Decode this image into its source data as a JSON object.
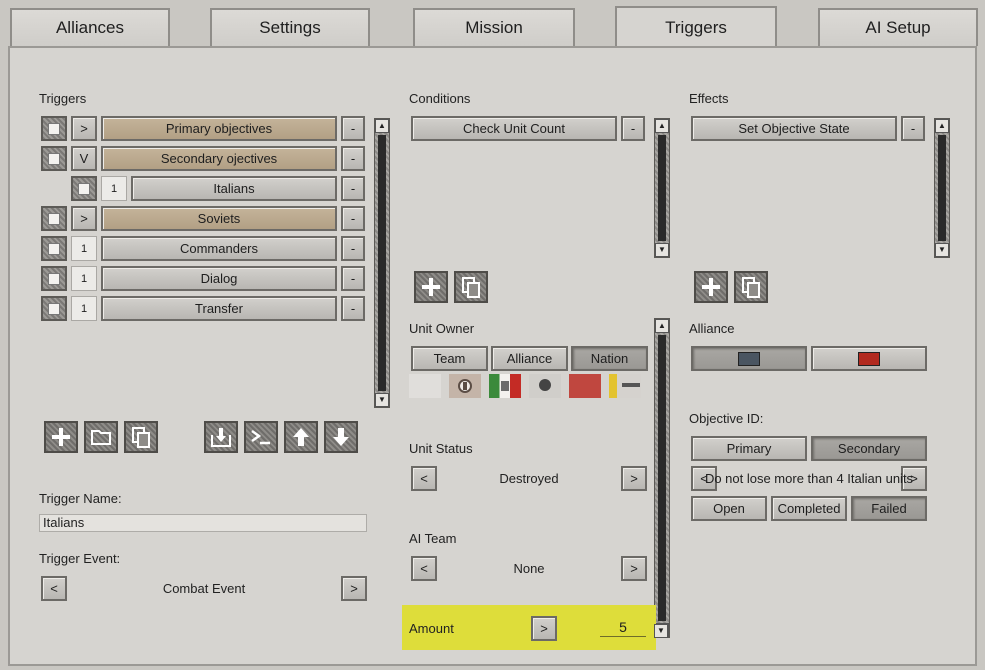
{
  "tabs": [
    {
      "label": "Alliances"
    },
    {
      "label": "Settings"
    },
    {
      "label": "Mission"
    },
    {
      "label": "Triggers"
    },
    {
      "label": "AI Setup"
    }
  ],
  "triggers": {
    "heading": "Triggers",
    "items": [
      {
        "expander": ">",
        "label": "Primary objectives",
        "minus": "-"
      },
      {
        "expander": "V",
        "label": "Secondary ojectives",
        "minus": "-"
      },
      {
        "expander": "1",
        "label": "Italians",
        "minus": "-"
      },
      {
        "expander": ">",
        "label": "Soviets",
        "minus": "-"
      },
      {
        "expander": "1",
        "label": "Commanders",
        "minus": "-"
      },
      {
        "expander": "1",
        "label": "Dialog",
        "minus": "-"
      },
      {
        "expander": "1",
        "label": "Transfer",
        "minus": "-"
      }
    ],
    "trigger_name_label": "Trigger Name:",
    "trigger_name_value": "Italians",
    "trigger_event_label": "Trigger Event:",
    "trigger_event_value": "Combat Event",
    "prev": "<",
    "next": ">"
  },
  "conditions": {
    "heading": "Conditions",
    "item": "Check Unit Count",
    "minus": "-",
    "unit_owner_label": "Unit Owner",
    "owner_tabs": [
      "Team",
      "Alliance",
      "Nation"
    ],
    "unit_status_label": "Unit Status",
    "unit_status_value": "Destroyed",
    "ai_team_label": "AI Team",
    "ai_team_value": "None",
    "amount_label": "Amount",
    "amount_btn": ">",
    "amount_value": "5",
    "prev": "<",
    "next": ">"
  },
  "effects": {
    "heading": "Effects",
    "item": "Set Objective State",
    "minus": "-",
    "alliance_label": "Alliance",
    "alliance_colors": [
      "#4a5561",
      "#b22a1f"
    ],
    "objective_id_label": "Objective ID:",
    "objective_tabs": [
      "Primary",
      "Secondary"
    ],
    "objective_text": "Do not lose more than 4 Italian units",
    "prev": "<",
    "next": ">",
    "state_buttons": [
      "Open",
      "Completed",
      "Failed"
    ]
  },
  "toolbar_icons": [
    "add-icon",
    "folder-icon",
    "copy-icon",
    "import-icon",
    "console-icon",
    "arrow-up-icon",
    "arrow-down-icon"
  ],
  "colors": {
    "highlight": "#dedd3a",
    "tan": "#bba98e"
  }
}
